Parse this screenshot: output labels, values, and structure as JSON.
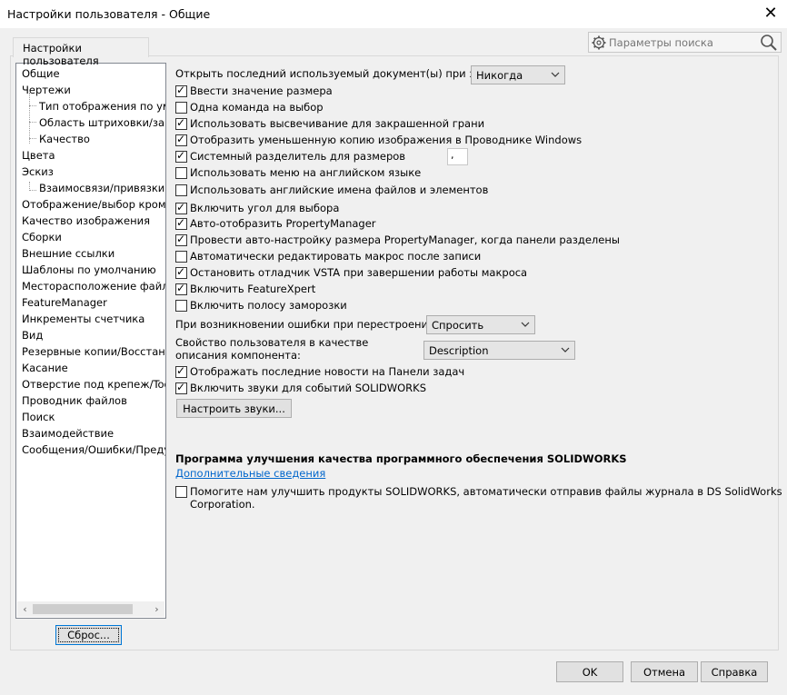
{
  "window": {
    "title": "Настройки пользователя - Общие",
    "close_glyph": "✕"
  },
  "tab": {
    "label": "Настройки пользователя"
  },
  "search": {
    "placeholder": "Параметры поиска"
  },
  "tree": {
    "items": [
      "Общие",
      "Чертежи",
      "Тип отображения по умо",
      "Область штриховки/запо",
      "Качество",
      "Цвета",
      "Эскиз",
      "Взаимосвязи/привязки",
      "Отображение/выбор кромки",
      "Качество изображения",
      "Сборки",
      "Внешние ссылки",
      "Шаблоны по умолчанию",
      "Месторасположение файло",
      "FeatureManager",
      "Инкременты счетчика",
      "Вид",
      "Резервные копии/Восстанов",
      "Касание",
      "Отверстие под крепеж/Toolb",
      "Проводник файлов",
      "Поиск",
      "Взаимодействие",
      "Сообщения/Ошибки/Преду"
    ],
    "scroll_left": "‹",
    "scroll_right": "›"
  },
  "reset_button": "Сброс...",
  "open_last_doc": {
    "label": "Открыть последний используемый документ(ы) при запуске:",
    "value": "Никогда"
  },
  "options": [
    {
      "label": "Ввести значение размера",
      "checked": true
    },
    {
      "label": "Одна команда на выбор",
      "checked": false
    },
    {
      "label": "Использовать высвечивание для закрашенной грани",
      "checked": true
    },
    {
      "label": "Отобразить уменьшенную копию изображения в Проводнике Windows",
      "checked": true
    },
    {
      "label": "Системный разделитель для размеров",
      "checked": true
    },
    {
      "label": "Использовать меню на английском языке",
      "checked": false
    },
    {
      "label": "Использовать английские имена файлов и элементов",
      "checked": false
    },
    {
      "label": "Включить угол для выбора",
      "checked": true
    },
    {
      "label": "Авто-отобразить PropertyManager",
      "checked": true
    },
    {
      "label": "Провести авто-настройку размера PropertyManager, когда панели разделены",
      "checked": true
    },
    {
      "label": "Автоматически редактировать макрос после записи",
      "checked": false
    },
    {
      "label": "Остановить отладчик VSTA при завершении работы макроса",
      "checked": true
    },
    {
      "label": "Включить FeatureXpert",
      "checked": true
    },
    {
      "label": "Включить полосу заморозки",
      "checked": false
    }
  ],
  "separator_value": ",",
  "rebuild_error": {
    "label": "При возникновении ошибки при перестроении:",
    "value": "Спросить"
  },
  "component_property": {
    "label_line1": "Свойство пользователя в качестве",
    "label_line2": "описания компонента:",
    "value": "Description"
  },
  "options2": [
    {
      "label": "Отображать последние новости на Панели задач",
      "checked": true
    },
    {
      "label": "Включить звуки для событий SOLIDWORKS",
      "checked": true
    }
  ],
  "configure_sounds_button": "Настроить звуки...",
  "improvement": {
    "heading": "Программа улучшения качества программного обеспечения SOLIDWORKS",
    "link": "Дополнительные сведения",
    "checkbox_line1": "Помогите нам улучшить продукты SOLIDWORKS, автоматически отправив файлы журнала в DS SolidWorks",
    "checkbox_line2": "Corporation.",
    "checked": false
  },
  "footer": {
    "ok": "OK",
    "cancel": "Отмена",
    "help": "Справка"
  }
}
